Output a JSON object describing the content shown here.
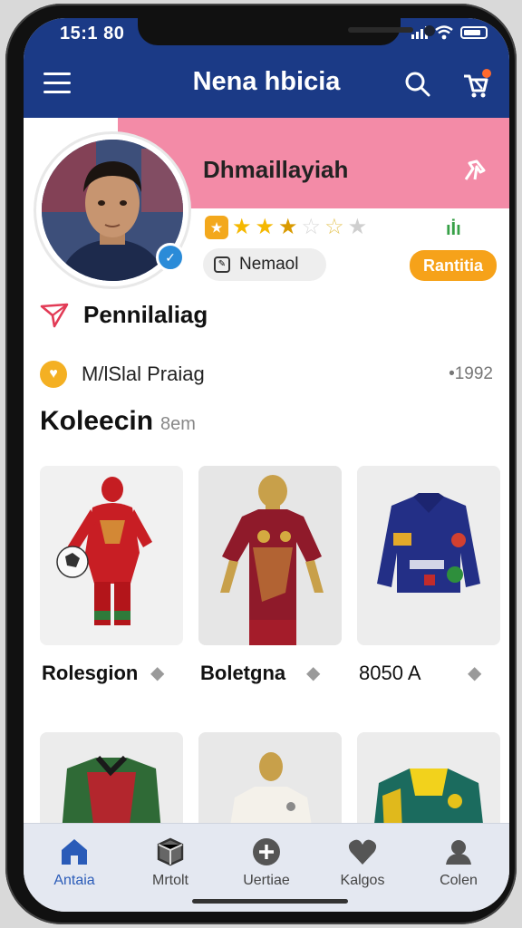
{
  "status": {
    "time": "15:1 80"
  },
  "appbar": {
    "title": "Nena hbicia"
  },
  "profile": {
    "name": "Dhmaillayiah",
    "chip_label": "Nemaol",
    "cta_label": "Rantitia",
    "rating": 3.5
  },
  "rows": [
    {
      "label": "Pennilaliag"
    },
    {
      "label": "M/lSlal Praiag",
      "value": "•1992"
    }
  ],
  "collection": {
    "title": "Koleecin",
    "subtitle": "8em"
  },
  "cards": [
    {
      "label": "Rolesgion"
    },
    {
      "label": "Boletgna"
    },
    {
      "label": "8050 A"
    },
    {
      "label": ""
    },
    {
      "label": ""
    },
    {
      "label": ""
    }
  ],
  "nav": [
    {
      "label": "Antaia",
      "icon": "home-icon"
    },
    {
      "label": "Mrtolt",
      "icon": "box-icon"
    },
    {
      "label": "Uertiae",
      "icon": "plus-circle-icon"
    },
    {
      "label": "Kalgos",
      "icon": "heart-icon"
    },
    {
      "label": "Colen",
      "icon": "profile-icon"
    }
  ],
  "colors": {
    "appbar": "#1b3a86",
    "banner": "#f38ba7",
    "accent": "#f6a21a",
    "active": "#2a5bb8"
  }
}
